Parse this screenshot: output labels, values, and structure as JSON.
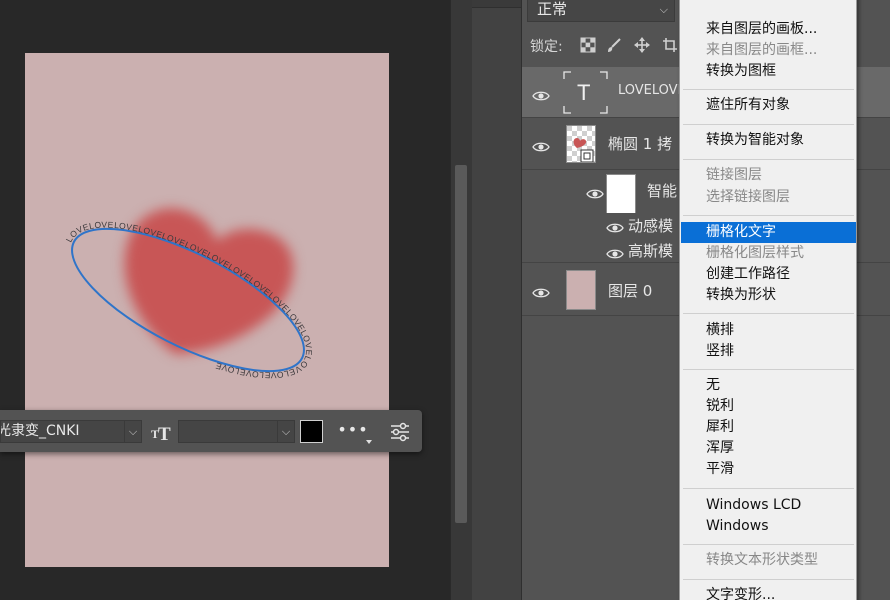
{
  "canvas": {
    "path_text": "LOVELOVELOVELOVELOVELOVELOVELOVELOVELOVELOVELOVELOVELOVELOVELOVE",
    "artboard_color": "#cbb0b0",
    "heart_color": "#c85656",
    "path_color": "#2f74c9"
  },
  "text_toolbar": {
    "font_family": "光隶变_CNKI",
    "font_size": "",
    "color": "#000000",
    "more_label": "•••"
  },
  "layers_panel": {
    "blend_mode": "正常",
    "lock_label": "锁定:",
    "layers": [
      {
        "name": "LOVELOVELOVELOVELOVELOVELOVELOVELOVELOVELOVELOVELOVELOVELOVELOVE",
        "kind": "text",
        "thumb_glyph": "T",
        "selected": true,
        "visible": true
      },
      {
        "name": "椭圆 1 拷",
        "kind": "smart-object",
        "visible": true
      },
      {
        "name": "智能",
        "kind": "smart-filter-mask",
        "visible": true
      },
      {
        "name": "动感模",
        "kind": "filter",
        "visible": true
      },
      {
        "name": "高斯模",
        "kind": "filter",
        "visible": true
      },
      {
        "name": "图层 0",
        "kind": "pixel",
        "visible": true
      }
    ]
  },
  "context_menu": {
    "items": [
      {
        "label": "来自图层的画板...",
        "disabled": false
      },
      {
        "label": "来自图层的画框...",
        "disabled": true
      },
      {
        "label": "转换为图框",
        "disabled": false
      },
      {
        "label": "遮住所有对象",
        "disabled": false
      },
      {
        "label": "转换为智能对象",
        "disabled": false
      },
      {
        "label": "链接图层",
        "disabled": true
      },
      {
        "label": "选择链接图层",
        "disabled": true
      },
      {
        "label": "栅格化文字",
        "disabled": false,
        "highlighted": true
      },
      {
        "label": "栅格化图层样式",
        "disabled": true
      },
      {
        "label": "创建工作路径",
        "disabled": false
      },
      {
        "label": "转换为形状",
        "disabled": false
      },
      {
        "label": "横排",
        "disabled": false
      },
      {
        "label": "竖排",
        "disabled": false
      },
      {
        "label": "无",
        "disabled": false
      },
      {
        "label": "锐利",
        "disabled": false
      },
      {
        "label": "犀利",
        "disabled": false
      },
      {
        "label": "浑厚",
        "disabled": false
      },
      {
        "label": "平滑",
        "disabled": false
      },
      {
        "label": "Windows LCD",
        "disabled": false
      },
      {
        "label": "Windows",
        "disabled": false
      },
      {
        "label": "转换文本形状类型",
        "disabled": true
      },
      {
        "label": "文字变形...",
        "disabled": false
      }
    ]
  }
}
